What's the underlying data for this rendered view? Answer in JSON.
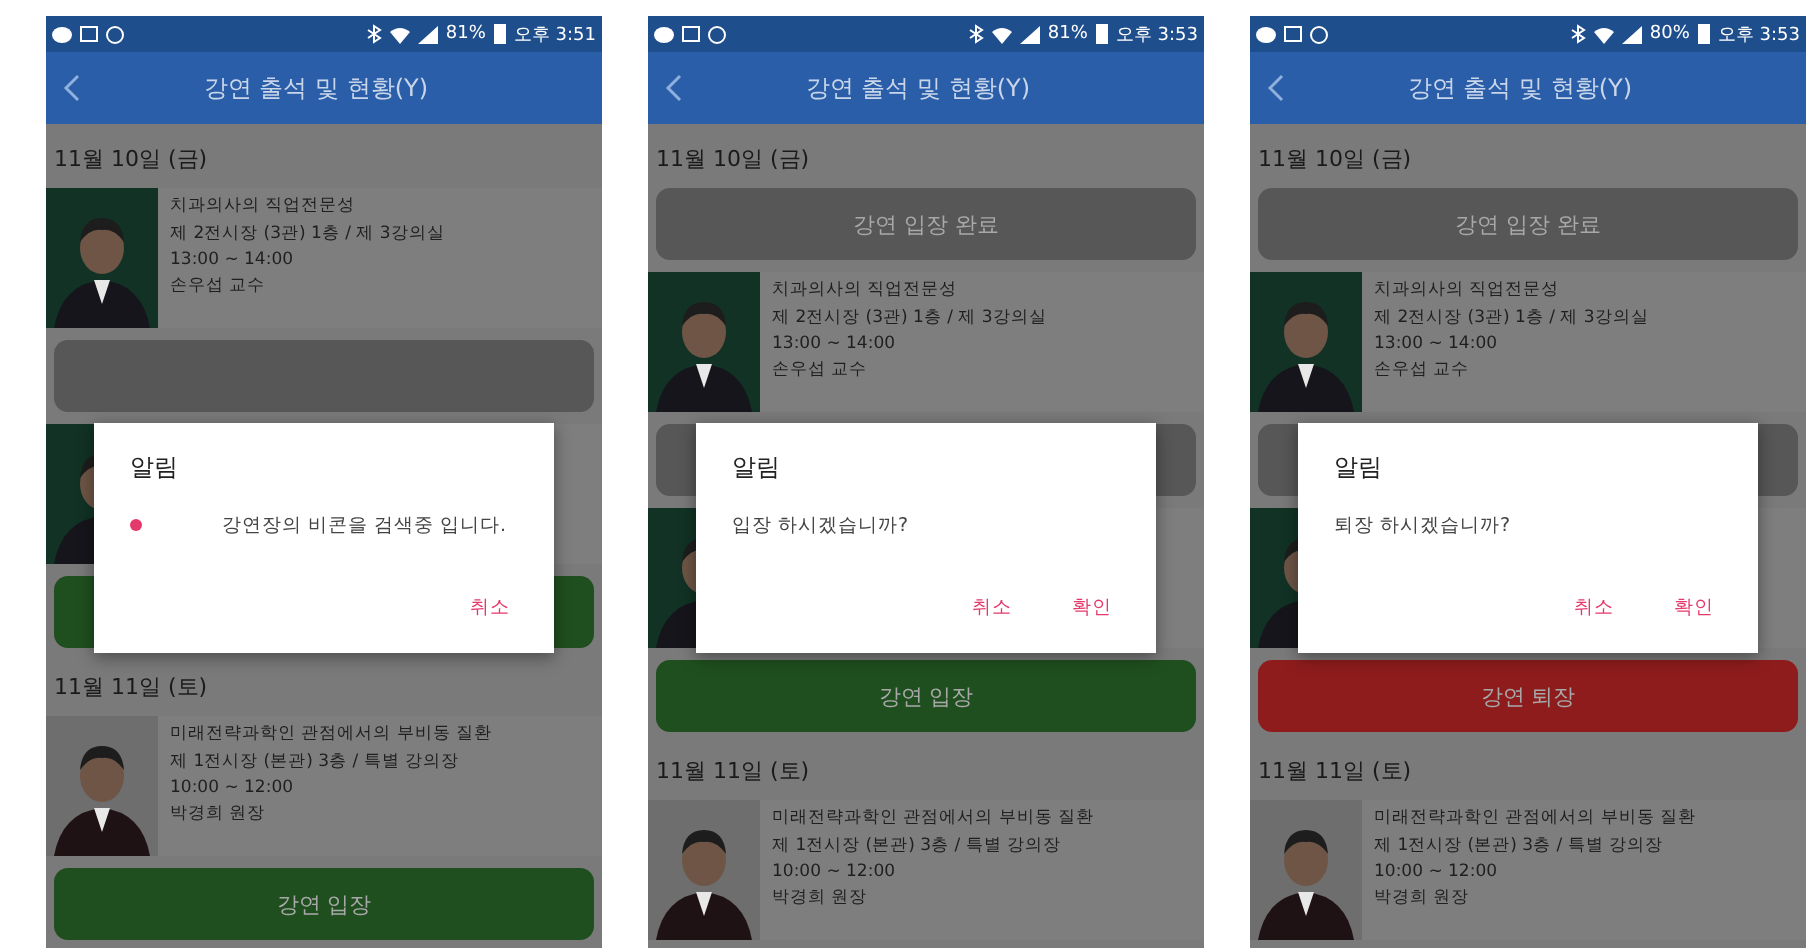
{
  "phones": [
    {
      "status_bar": {
        "battery": "81%",
        "time": "오후 3:51"
      },
      "app_bar": {
        "title": "강연 출석 및 현황(Y)"
      },
      "items": [
        {
          "kind": "date",
          "text": "11월 10일 (금)"
        },
        {
          "kind": "lecture",
          "title": "치과의사의 직업전문성",
          "place": "제 2전시장 (3관) 1층 / 제 3강의실",
          "time": "13:00 ~ 14:00",
          "speaker": "손우섭 교수"
        },
        {
          "kind": "button",
          "color": "#575757"
        },
        {
          "kind": "lecture"
        },
        {
          "kind": "button",
          "color": "#1f4f1f"
        },
        {
          "kind": "date",
          "text": "11월 11일 (토)"
        },
        {
          "kind": "lecture",
          "title": "미래전략과학인 관점에서의 부비동 질환",
          "place": "제 1전시장 (본관) 3층 / 특별 강의장",
          "time": "10:00 ~ 12:00",
          "speaker": "박경희 원장"
        },
        {
          "kind": "button",
          "color": "#1f4f1f",
          "label": "강연 입장"
        }
      ],
      "dialog": {
        "title": "알림",
        "message": "강연장의 비콘을 검색중 입니다.",
        "spinner": true,
        "buttons": [
          "취소"
        ]
      }
    },
    {
      "status_bar": {
        "battery": "81%",
        "time": "오후 3:53"
      },
      "app_bar": {
        "title": "강연 출석 및 현황(Y)"
      },
      "items": [
        {
          "kind": "date",
          "text": "11월 10일 (금)"
        },
        {
          "kind": "button",
          "color": "#575757",
          "label": "강연 입장 완료"
        },
        {
          "kind": "lecture",
          "title": "치과의사의 직업전문성",
          "place": "제 2전시장 (3관) 1층 / 제 3강의실",
          "time": "13:00 ~ 14:00",
          "speaker": "손우섭 교수"
        },
        {
          "kind": "button",
          "color": "#575757"
        },
        {
          "kind": "lecture"
        },
        {
          "kind": "button",
          "color": "#1f4f1f",
          "label": "강연 입장"
        },
        {
          "kind": "date",
          "text": "11월 11일 (토)"
        },
        {
          "kind": "lecture",
          "title": "미래전략과학인 관점에서의 부비동 질환",
          "place": "제 1전시장 (본관) 3층 / 특별 강의장",
          "time": "10:00 ~ 12:00",
          "speaker": "박경희 원장"
        }
      ],
      "dialog": {
        "title": "알림",
        "message": "입장 하시겠습니까?",
        "spinner": false,
        "buttons": [
          "취소",
          "확인"
        ]
      }
    },
    {
      "status_bar": {
        "battery": "80%",
        "time": "오후 3:53"
      },
      "app_bar": {
        "title": "강연 출석 및 현황(Y)"
      },
      "items": [
        {
          "kind": "date",
          "text": "11월 10일 (금)"
        },
        {
          "kind": "button",
          "color": "#575757",
          "label": "강연 입장 완료"
        },
        {
          "kind": "lecture",
          "title": "치과의사의 직업전문성",
          "place": "제 2전시장 (3관) 1층 / 제 3강의실",
          "time": "13:00 ~ 14:00",
          "speaker": "손우섭 교수"
        },
        {
          "kind": "button",
          "color": "#575757"
        },
        {
          "kind": "lecture"
        },
        {
          "kind": "button",
          "color": "#8e1c1c",
          "label": "강연 퇴장"
        },
        {
          "kind": "date",
          "text": "11월 11일 (토)"
        },
        {
          "kind": "lecture",
          "title": "미래전략과학인 관점에서의 부비동 질환",
          "place": "제 1전시장 (본관) 3층 / 특별 강의장",
          "time": "10:00 ~ 12:00",
          "speaker": "박경희 원장"
        }
      ],
      "dialog": {
        "title": "알림",
        "message": "퇴장 하시겠습니까?",
        "spinner": false,
        "buttons": [
          "취소",
          "확인"
        ]
      }
    }
  ]
}
